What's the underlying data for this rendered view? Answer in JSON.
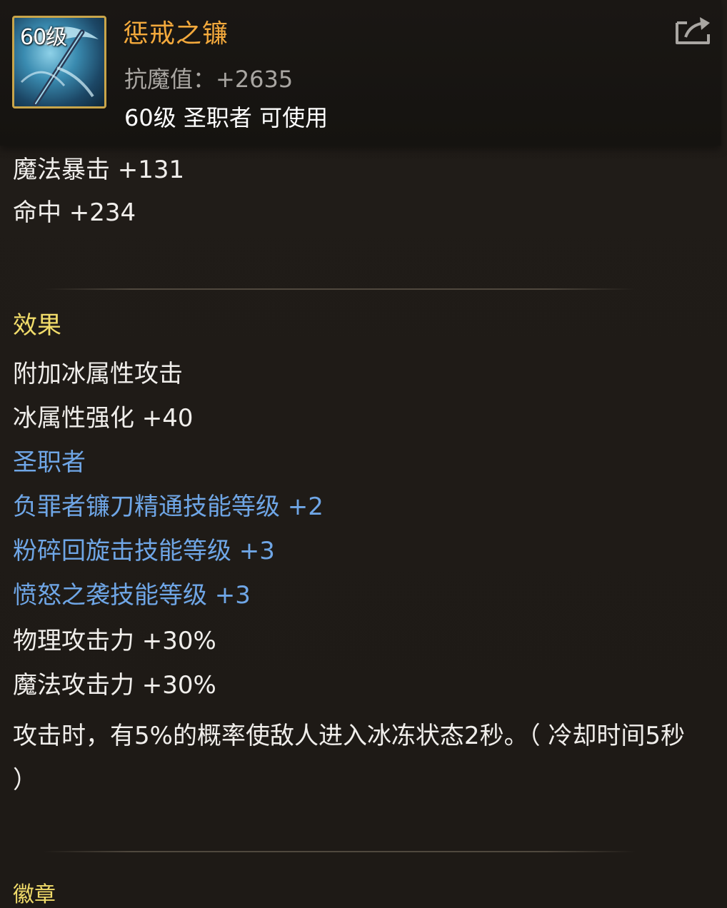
{
  "item": {
    "level_badge": "60级",
    "name": "惩戒之镰",
    "stat": "抗魔值：+2635",
    "requirement": "60级 圣职者 可使用"
  },
  "stats": [
    "魔法暴击 +131",
    "命中 +234"
  ],
  "effects": {
    "heading": "效果",
    "lines": [
      "附加冰属性攻击",
      "冰属性强化 +40"
    ],
    "class_heading": "圣职者",
    "skill_lines": [
      "负罪者镰刀精通技能等级 +2",
      "粉碎回旋击技能等级 +3",
      "愤怒之袭技能等级 +3"
    ],
    "after_lines": [
      "物理攻击力 +30%",
      "魔法攻击力 +30%"
    ],
    "description": "攻击时，有5%的概率使敌人进入冰冻状态2秒。（ 冷却时间5秒 ）"
  },
  "next_section": "徽章",
  "icons": {
    "item": "scythe-icon",
    "share": "share-icon"
  },
  "colors": {
    "name": "#f3a93c",
    "section_heading": "#f1dc6a",
    "class_skill": "#6fa6e6",
    "icon_border": "#c9a54a"
  }
}
